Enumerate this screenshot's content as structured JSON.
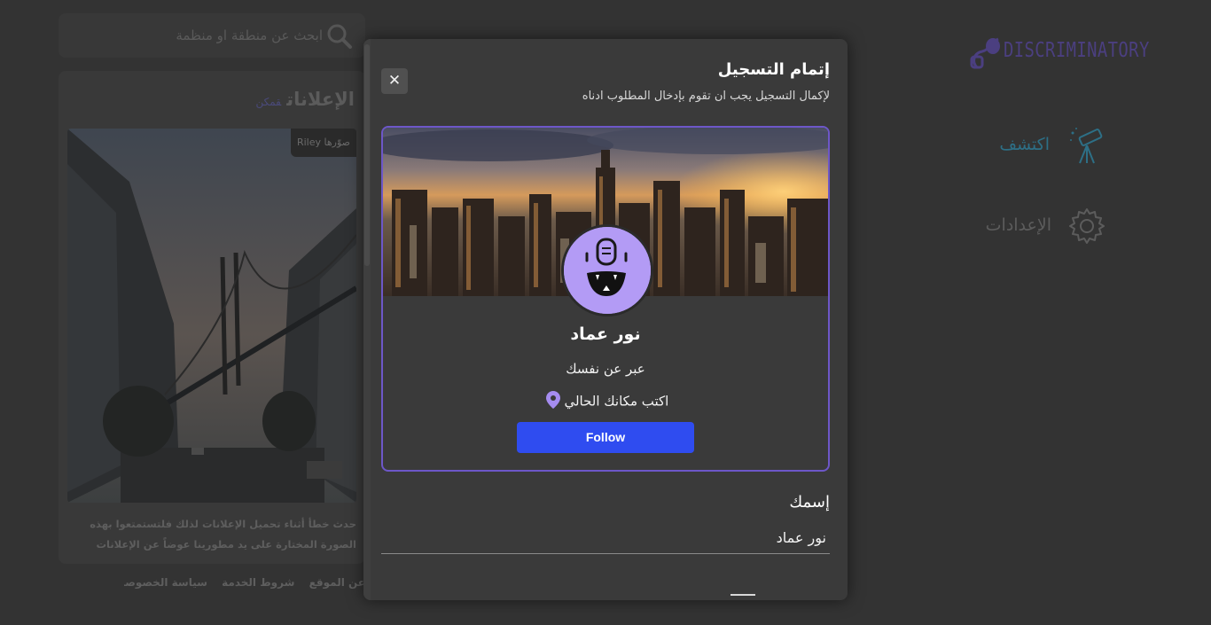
{
  "search": {
    "placeholder": "ابحث عن منطقة او منظمة"
  },
  "ads": {
    "title": "الإعلانات",
    "title_sub": "قمكن",
    "photo_credit": "صوّرها Riley",
    "error_text": "حدث خطأ أثناء تحميل الإعلانات لذلك فلتستمتعوا بهذه الصورة المختارة على يد مطورينا عوضاً عن الإعلانات"
  },
  "footer": {
    "links": [
      "عن الموقع",
      "شروط الخدمة",
      "سياسة الخصوصية"
    ]
  },
  "brand": {
    "name": "DISCRIMINATORY",
    "color": "#4b3f80"
  },
  "nav": {
    "items": [
      {
        "label": "اكتشف",
        "icon": "telescope-icon",
        "active": true
      },
      {
        "label": "الإعدادات",
        "icon": "gear-icon",
        "active": false
      }
    ]
  },
  "modal": {
    "title": "إتمام التسجيل",
    "subtitle": "لإكمال التسجيل يجب ان تقوم بإدخال المطلوب ادناه",
    "close_symbol": "✕",
    "profile": {
      "name": "نور عماد",
      "bio": "عبر عن نفسك",
      "location": "اكتب مكانك الحالي",
      "follow_label": "Follow"
    },
    "form": {
      "name_label": "إسمك",
      "name_value": "نور عماد"
    }
  },
  "colors": {
    "accent": "#6d57c8",
    "follow_button": "#2f4cf0",
    "avatar_bg": "#b39bf5",
    "explore_color": "#2d6f86"
  }
}
